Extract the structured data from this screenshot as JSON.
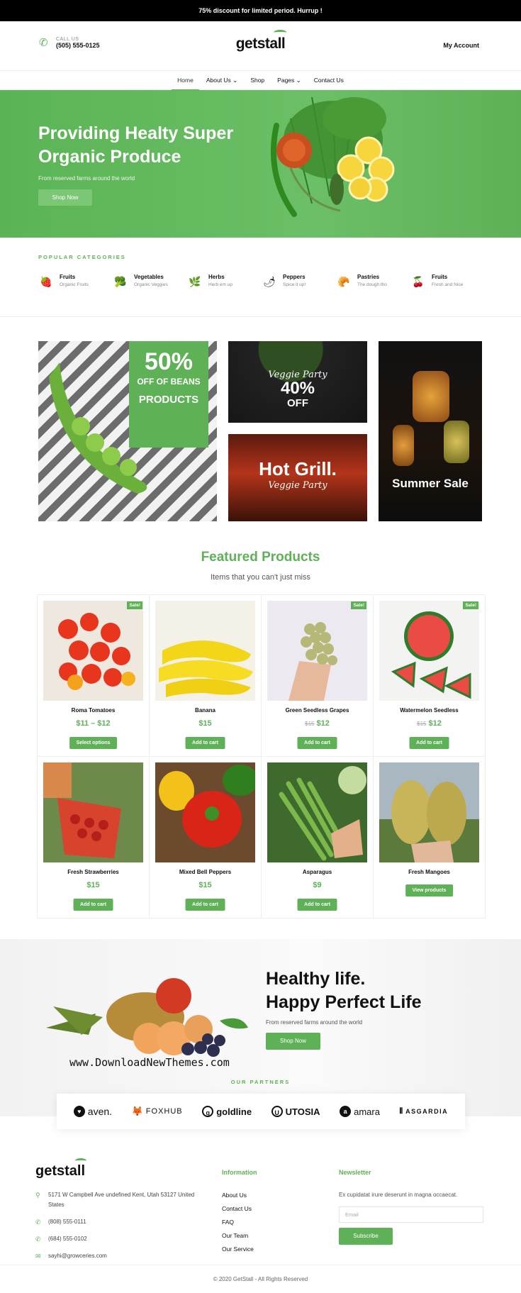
{
  "topbar": {
    "text": "75% discount for limited period. Hurrup !"
  },
  "header": {
    "call_label": "CALL US",
    "phone": "(505) 555-0125",
    "logo": "getstall",
    "account": "My Account"
  },
  "nav": {
    "items": [
      "Home",
      "About Us",
      "Shop",
      "Pages",
      "Contact Us"
    ]
  },
  "hero": {
    "title": "Providing Healty Super Organic Produce",
    "subtitle": "From reserved farms around the world",
    "button": "Shop Now"
  },
  "categories": {
    "title": "POPULAR CATEGORIES",
    "items": [
      {
        "name": "Fruits",
        "desc": "Organic Fruits"
      },
      {
        "name": "Vegetables",
        "desc": "Organic Veggies"
      },
      {
        "name": "Herbs",
        "desc": "Herb em up"
      },
      {
        "name": "Peppers",
        "desc": "Spice it up!"
      },
      {
        "name": "Pastries",
        "desc": "The dough tho"
      },
      {
        "name": "Fruits",
        "desc": "Fresh and Nice"
      }
    ]
  },
  "promos": {
    "beans": {
      "big": "50%",
      "line1": "OFF OF BEANS",
      "line2": "PRODUCTS"
    },
    "veggie": {
      "script": "Veggie Party",
      "pct": "40%",
      "off": "OFF"
    },
    "grill": {
      "big": "Hot Grill.",
      "script": "Veggie Party"
    },
    "summer": {
      "text": "Summer Sale"
    }
  },
  "featured": {
    "title": "Featured Products",
    "subtitle": "Items that you can't just miss",
    "sale_label": "Sale!",
    "products": [
      {
        "name": "Roma Tomatoes",
        "price": "$11 – $12",
        "old": "",
        "button": "Select options",
        "sale": true
      },
      {
        "name": "Banana",
        "price": "$15",
        "old": "",
        "button": "Add to cart",
        "sale": false
      },
      {
        "name": "Green Seedless Grapes",
        "price": "$12",
        "old": "$15",
        "button": "Add to cart",
        "sale": true
      },
      {
        "name": "Watermelon Seedless",
        "price": "$12",
        "old": "$15",
        "button": "Add to cart",
        "sale": true
      },
      {
        "name": "Fresh Strawberries",
        "price": "$15",
        "old": "",
        "button": "Add to cart",
        "sale": false
      },
      {
        "name": "Mixed Bell Peppers",
        "price": "$15",
        "old": "",
        "button": "Add to cart",
        "sale": false
      },
      {
        "name": "Asparagus",
        "price": "$9",
        "old": "",
        "button": "Add to cart",
        "sale": false
      },
      {
        "name": "Fresh Mangoes",
        "price": "",
        "old": "",
        "button": "View products",
        "sale": false
      }
    ]
  },
  "healthy": {
    "line1": "Healthy life.",
    "line2": "Happy Perfect Life",
    "subtitle": "From reserved farms around the world",
    "button": "Shop Now",
    "watermark": "www.DownloadNewThemes.com"
  },
  "partners": {
    "title": "OUR PARTNERS",
    "items": [
      "aven.",
      "FOXHUB",
      "goldline",
      "UTOSIA",
      "amara",
      "ASGARDIA"
    ]
  },
  "footer": {
    "logo": "getstall",
    "address": "5171 W Campbell Ave undefined Kent, Utah 53127 United States",
    "phone1": "(808) 555-0111",
    "phone2": "(684) 555-0102",
    "email": "sayhi@growceries.com",
    "info_title": "Information",
    "links": [
      "About Us",
      "Contact Us",
      "FAQ",
      "Our Team",
      "Our Service"
    ],
    "newsletter_title": "Newsletter",
    "newsletter_text": "Ex cupidatat irure deserunt in magna occaecat.",
    "email_placeholder": "Email",
    "subscribe": "Subscribe",
    "copyright": "© 2020 GetStall - All Rights Reserved"
  }
}
